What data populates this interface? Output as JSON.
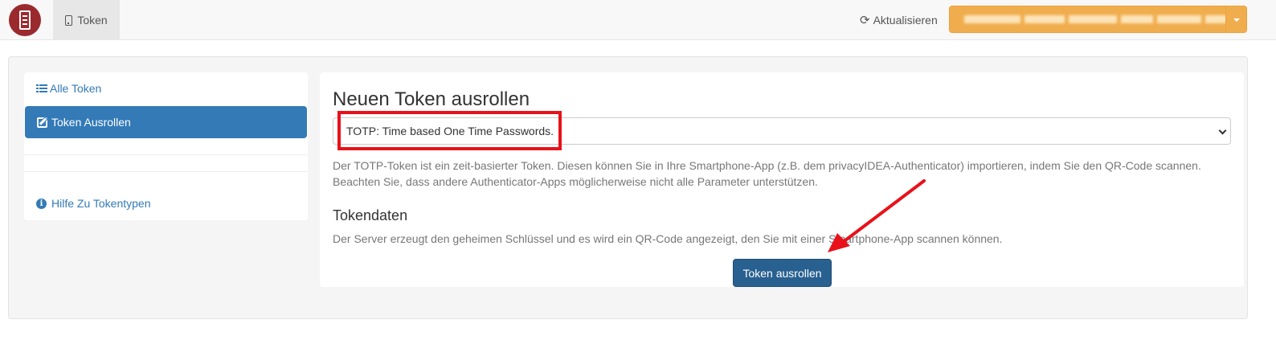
{
  "navbar": {
    "logo_icon": "privacyidea-logo",
    "token_tab_label": "Token",
    "token_tab_icon": "phone-icon",
    "refresh_label": "Aktualisieren",
    "refresh_icon": "refresh-icon",
    "user_menu_icon": "caret-down-icon"
  },
  "sidebar": {
    "items": [
      {
        "label": "Alle Token",
        "icon": "list-icon",
        "active": false
      },
      {
        "label": "Token Ausrollen",
        "icon": "edit-icon",
        "active": true
      },
      {
        "label": "Hilfe Zu Tokentypen",
        "icon": "info-icon",
        "active": false
      }
    ]
  },
  "main": {
    "title": "Neuen Token ausrollen",
    "token_type_selected": "TOTP: Time based One Time Passwords.",
    "description": "Der TOTP-Token ist ein zeit-basierter Token. Diesen können Sie in Ihre Smartphone-App (z.B. dem privacyIDEA-Authenticator) importieren, indem Sie den QR-Code scannen. Beachten Sie, dass andere Authenticator-Apps möglicherweise nicht alle Parameter unterstützen.",
    "tokendata_heading": "Tokendaten",
    "tokendata_text": "Der Server erzeugt den geheimen Schlüssel und es wird ein QR-Code angezeigt, den Sie mit einer Smartphone-App scannen können.",
    "submit_label": "Token ausrollen"
  },
  "colors": {
    "primary": "#337ab7",
    "primary_dark": "#286090",
    "warning": "#f0ad4e",
    "annotation_red": "#e8111a",
    "logo_red": "#9a2a2e"
  }
}
